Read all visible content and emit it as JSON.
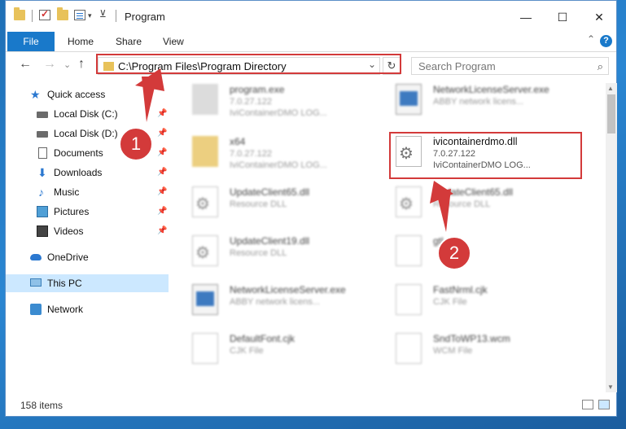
{
  "window": {
    "title": "Program",
    "controls": {
      "minimize": "—",
      "maximize": "☐",
      "close": "✕"
    }
  },
  "ribbon": {
    "tabs": [
      "File",
      "Home",
      "Share",
      "View"
    ],
    "help": "?",
    "collapse": "⌃"
  },
  "nav": {
    "back": "←",
    "forward": "→",
    "recent": "⌄",
    "up": "↑",
    "address": "C:\\Program Files\\Program Directory",
    "address_drop": "⌄",
    "refresh": "↻",
    "search_placeholder": "Search Program",
    "search_icon": "⌕"
  },
  "sidebar": {
    "pin_glyph": "📌",
    "items": [
      {
        "label": "Quick access",
        "icon": "star-icon",
        "glyph": "★"
      },
      {
        "label": "Local Disk (C:)",
        "icon": "disk-icon",
        "pinned": true
      },
      {
        "label": "Local Disk (D:)",
        "icon": "disk-icon",
        "pinned": true
      },
      {
        "label": "Documents",
        "icon": "documents-icon",
        "pinned": true
      },
      {
        "label": "Downloads",
        "icon": "downloads-icon",
        "glyph": "⬇",
        "pinned": true
      },
      {
        "label": "Music",
        "icon": "music-icon",
        "glyph": "♪",
        "pinned": true
      },
      {
        "label": "Pictures",
        "icon": "pictures-icon",
        "pinned": true
      },
      {
        "label": "Videos",
        "icon": "videos-icon",
        "pinned": true
      },
      {
        "label": "OneDrive",
        "icon": "onedrive-icon"
      },
      {
        "label": "This PC",
        "icon": "this-pc-icon",
        "selected": true
      },
      {
        "label": "Network",
        "icon": "network-icon"
      }
    ]
  },
  "files": [
    {
      "name": "program.exe",
      "line2": "7.0.27.122",
      "line3": "IviContainerDMO LOG...",
      "icon": "app"
    },
    {
      "name": "NetworkLicenseServer.exe",
      "line2": "ABBY network licens...",
      "line3": "",
      "icon": "blue"
    },
    {
      "name": "x64",
      "line2": "7.0.27.122",
      "line3": "IviContainerDMO LOG...",
      "icon": "folder"
    },
    {
      "name": "ivicontainerdmo.dll",
      "line2": "7.0.27.122",
      "line3": "IviContainerDMO LOG...",
      "icon": "gear",
      "highlight": true
    },
    {
      "name": "UpdateClient65.dll",
      "line2": "Resource DLL",
      "line3": "",
      "icon": "gear"
    },
    {
      "name": "UpdateClient65.dll",
      "line2": "Resource DLL",
      "line3": "",
      "icon": "gear"
    },
    {
      "name": "UpdateClient19.dll",
      "line2": "Resource DLL",
      "line3": "",
      "icon": "gear"
    },
    {
      "name": "gtl...",
      "line2": "",
      "line3": "",
      "icon": "plain"
    },
    {
      "name": "NetworkLicenseServer.exe",
      "line2": "ABBY network licens...",
      "line3": "",
      "icon": "blue"
    },
    {
      "name": "FastNrml.cjk",
      "line2": "CJK File",
      "line3": "",
      "icon": "plain"
    },
    {
      "name": "DefaultFont.cjk",
      "line2": "CJK File",
      "line3": "",
      "icon": "plain"
    },
    {
      "name": "SndToWP13.wcm",
      "line2": "WCM File",
      "line3": "",
      "icon": "plain"
    }
  ],
  "status": {
    "count": "158 items"
  },
  "annotations": {
    "badge1": "1",
    "badge2": "2"
  },
  "colors": {
    "accent": "#1979ca",
    "highlight": "#d33a3a",
    "selected": "#cce8ff"
  }
}
